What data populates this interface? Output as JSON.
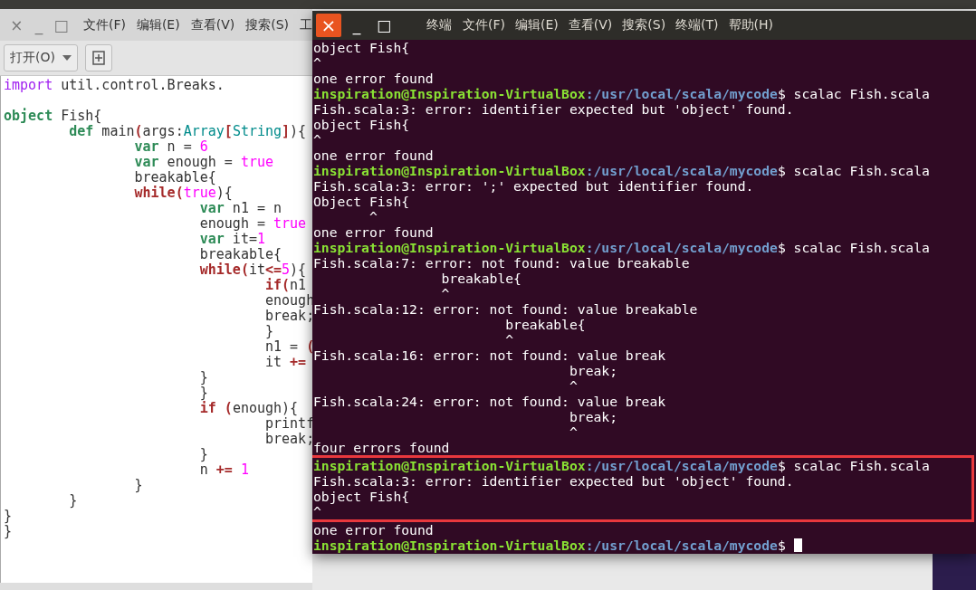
{
  "editor": {
    "window_controls": [
      "×",
      "_",
      "□"
    ],
    "menu": [
      "文件(F)",
      "编辑(E)",
      "查看(V)",
      "搜索(S)",
      "工"
    ],
    "open_button": "打开(O)",
    "code_lines": [
      {
        "kind": "code",
        "tokens": [
          {
            "text": "import",
            "kind": "import"
          },
          {
            "text": " util.control.Breaks.",
            "kind": "plain"
          }
        ]
      },
      {
        "kind": "blank"
      },
      {
        "kind": "code",
        "tokens": [
          {
            "text": "object",
            "kind": "keyword"
          },
          {
            "text": " Fish{",
            "kind": "plain"
          }
        ]
      },
      {
        "kind": "code",
        "tokens": [
          {
            "text": "\tdef",
            "kind": "keyword"
          },
          {
            "text": " main",
            "kind": "plain"
          },
          {
            "text": "(",
            "kind": "op"
          },
          {
            "text": "args:",
            "kind": "plain"
          },
          {
            "text": "Array",
            "kind": "type"
          },
          {
            "text": "[",
            "kind": "op"
          },
          {
            "text": "String",
            "kind": "type"
          },
          {
            "text": "]",
            "kind": "op"
          },
          {
            "text": "){",
            "kind": "plain"
          }
        ]
      },
      {
        "kind": "code",
        "tokens": [
          {
            "text": "\t\tvar",
            "kind": "keyword"
          },
          {
            "text": " n = ",
            "kind": "plain"
          },
          {
            "text": "6",
            "kind": "literal"
          }
        ]
      },
      {
        "kind": "code",
        "tokens": [
          {
            "text": "\t\tvar",
            "kind": "keyword"
          },
          {
            "text": " enough = ",
            "kind": "plain"
          },
          {
            "text": "true",
            "kind": "literal"
          }
        ]
      },
      {
        "kind": "code",
        "tokens": [
          {
            "text": "\t\tbreakable{",
            "kind": "plain"
          }
        ]
      },
      {
        "kind": "code",
        "tokens": [
          {
            "text": "\t\twhile",
            "kind": "control"
          },
          {
            "text": "(",
            "kind": "op"
          },
          {
            "text": "true",
            "kind": "literal"
          },
          {
            "text": "){",
            "kind": "plain"
          }
        ]
      },
      {
        "kind": "code",
        "tokens": [
          {
            "text": "\t\t\tvar",
            "kind": "keyword"
          },
          {
            "text": " n1 = n",
            "kind": "plain"
          }
        ]
      },
      {
        "kind": "code",
        "tokens": [
          {
            "text": "\t\t\tenough = ",
            "kind": "plain"
          },
          {
            "text": "true",
            "kind": "literal"
          }
        ]
      },
      {
        "kind": "code",
        "tokens": [
          {
            "text": "\t\t\tvar",
            "kind": "keyword"
          },
          {
            "text": " it=",
            "kind": "plain"
          },
          {
            "text": "1",
            "kind": "literal"
          }
        ]
      },
      {
        "kind": "code",
        "tokens": [
          {
            "text": "\t\t\tbreakable{",
            "kind": "plain"
          }
        ]
      },
      {
        "kind": "code",
        "tokens": [
          {
            "text": "\t\t\twhile",
            "kind": "control"
          },
          {
            "text": "(",
            "kind": "op"
          },
          {
            "text": "it",
            "kind": "plain"
          },
          {
            "text": "<=",
            "kind": "op"
          },
          {
            "text": "5",
            "kind": "literal"
          },
          {
            "text": "){",
            "kind": "plain"
          }
        ]
      },
      {
        "kind": "code",
        "tokens": [
          {
            "text": "\t\t\t\tif",
            "kind": "control"
          },
          {
            "text": "(",
            "kind": "op"
          },
          {
            "text": "n1",
            "kind": "plain"
          }
        ]
      },
      {
        "kind": "code",
        "tokens": [
          {
            "text": "\t\t\t\tenough",
            "kind": "plain"
          }
        ]
      },
      {
        "kind": "code",
        "tokens": [
          {
            "text": "\t\t\t\tbreak;",
            "kind": "plain"
          }
        ]
      },
      {
        "kind": "code",
        "tokens": [
          {
            "text": "\t\t\t\t}",
            "kind": "plain"
          }
        ]
      },
      {
        "kind": "code",
        "tokens": [
          {
            "text": "\t\t\t\tn1 = ",
            "kind": "plain"
          },
          {
            "text": "(",
            "kind": "op"
          }
        ]
      },
      {
        "kind": "code",
        "tokens": [
          {
            "text": "\t\t\t\tit ",
            "kind": "plain"
          },
          {
            "text": "+=",
            "kind": "op"
          }
        ]
      },
      {
        "kind": "code",
        "tokens": [
          {
            "text": "\t\t\t}",
            "kind": "plain"
          }
        ]
      },
      {
        "kind": "code",
        "tokens": [
          {
            "text": "\t\t\t}",
            "kind": "plain"
          }
        ]
      },
      {
        "kind": "code",
        "tokens": [
          {
            "text": "\t\t\tif",
            "kind": "control"
          },
          {
            "text": " (",
            "kind": "op"
          },
          {
            "text": "enough){",
            "kind": "plain"
          }
        ]
      },
      {
        "kind": "code",
        "tokens": [
          {
            "text": "\t\t\t\tprintf",
            "kind": "plain"
          }
        ]
      },
      {
        "kind": "code",
        "tokens": [
          {
            "text": "\t\t\t\tbreak;",
            "kind": "plain"
          }
        ]
      },
      {
        "kind": "code",
        "tokens": [
          {
            "text": "\t\t\t}",
            "kind": "plain"
          }
        ]
      },
      {
        "kind": "code",
        "tokens": [
          {
            "text": "\t\t\tn ",
            "kind": "plain"
          },
          {
            "text": "+=",
            "kind": "op"
          },
          {
            "text": " 1",
            "kind": "literal"
          }
        ]
      },
      {
        "kind": "code",
        "tokens": [
          {
            "text": "\t\t}",
            "kind": "plain"
          }
        ]
      },
      {
        "kind": "code",
        "tokens": [
          {
            "text": "\t}",
            "kind": "plain"
          }
        ]
      },
      {
        "kind": "code",
        "tokens": [
          {
            "text": "}",
            "kind": "plain"
          }
        ]
      },
      {
        "kind": "code",
        "tokens": [
          {
            "text": "}",
            "kind": "plain"
          }
        ]
      }
    ]
  },
  "terminal": {
    "window_controls": [
      "×",
      "_",
      "□"
    ],
    "title": "终端",
    "menu": [
      "文件(F)",
      "编辑(E)",
      "查看(V)",
      "搜索(S)",
      "终端(T)",
      "帮助(H)"
    ],
    "lines_before": [
      {
        "kind": "output",
        "text": "object Fish{"
      },
      {
        "kind": "output",
        "text": "^"
      },
      {
        "kind": "output",
        "text": "one error found"
      },
      {
        "kind": "prompt",
        "user": "inspiration@Inspiration-VirtualBox",
        "path": ":/usr/local/scala/mycode",
        "command": "$ scalac Fish.scala",
        "cursor": false
      },
      {
        "kind": "output",
        "text": "Fish.scala:3: error: identifier expected but 'object' found."
      },
      {
        "kind": "output",
        "text": "object Fish{"
      },
      {
        "kind": "output",
        "text": "^"
      },
      {
        "kind": "output",
        "text": "one error found"
      },
      {
        "kind": "prompt",
        "user": "inspiration@Inspiration-VirtualBox",
        "path": ":/usr/local/scala/mycode",
        "command": "$ scalac Fish.scala",
        "cursor": false
      },
      {
        "kind": "output",
        "text": "Fish.scala:3: error: ';' expected but identifier found."
      },
      {
        "kind": "output",
        "text": "Object Fish{"
      },
      {
        "kind": "output",
        "text": "       ^"
      },
      {
        "kind": "output",
        "text": "one error found"
      },
      {
        "kind": "prompt",
        "user": "inspiration@Inspiration-VirtualBox",
        "path": ":/usr/local/scala/mycode",
        "command": "$ scalac Fish.scala",
        "cursor": false
      },
      {
        "kind": "output",
        "text": "Fish.scala:7: error: not found: value breakable"
      },
      {
        "kind": "output",
        "text": "                breakable{"
      },
      {
        "kind": "output",
        "text": "                ^"
      },
      {
        "kind": "output",
        "text": "Fish.scala:12: error: not found: value breakable"
      },
      {
        "kind": "output",
        "text": "                        breakable{"
      },
      {
        "kind": "output",
        "text": "                        ^"
      },
      {
        "kind": "output",
        "text": "Fish.scala:16: error: not found: value break"
      },
      {
        "kind": "output",
        "text": "                                break;"
      },
      {
        "kind": "output",
        "text": "                                ^"
      },
      {
        "kind": "output",
        "text": "Fish.scala:24: error: not found: value break"
      },
      {
        "kind": "output",
        "text": "                                break;"
      },
      {
        "kind": "output",
        "text": "                                ^"
      },
      {
        "kind": "output",
        "text": "four errors found"
      }
    ],
    "highlighted_lines": [
      {
        "kind": "prompt",
        "user": "inspiration@Inspiration-VirtualBox",
        "path": ":/usr/local/scala/mycode",
        "command": "$ scalac Fish.scala",
        "cursor": false
      },
      {
        "kind": "output",
        "text": "Fish.scala:3: error: identifier expected but 'object' found."
      },
      {
        "kind": "output",
        "text": "object Fish{"
      },
      {
        "kind": "output",
        "text": "^"
      }
    ],
    "lines_after": [
      {
        "kind": "output",
        "text": "one error found"
      },
      {
        "kind": "prompt",
        "user": "inspiration@Inspiration-VirtualBox",
        "path": ":/usr/local/scala/mycode",
        "command": "$",
        "cursor": true
      }
    ]
  }
}
